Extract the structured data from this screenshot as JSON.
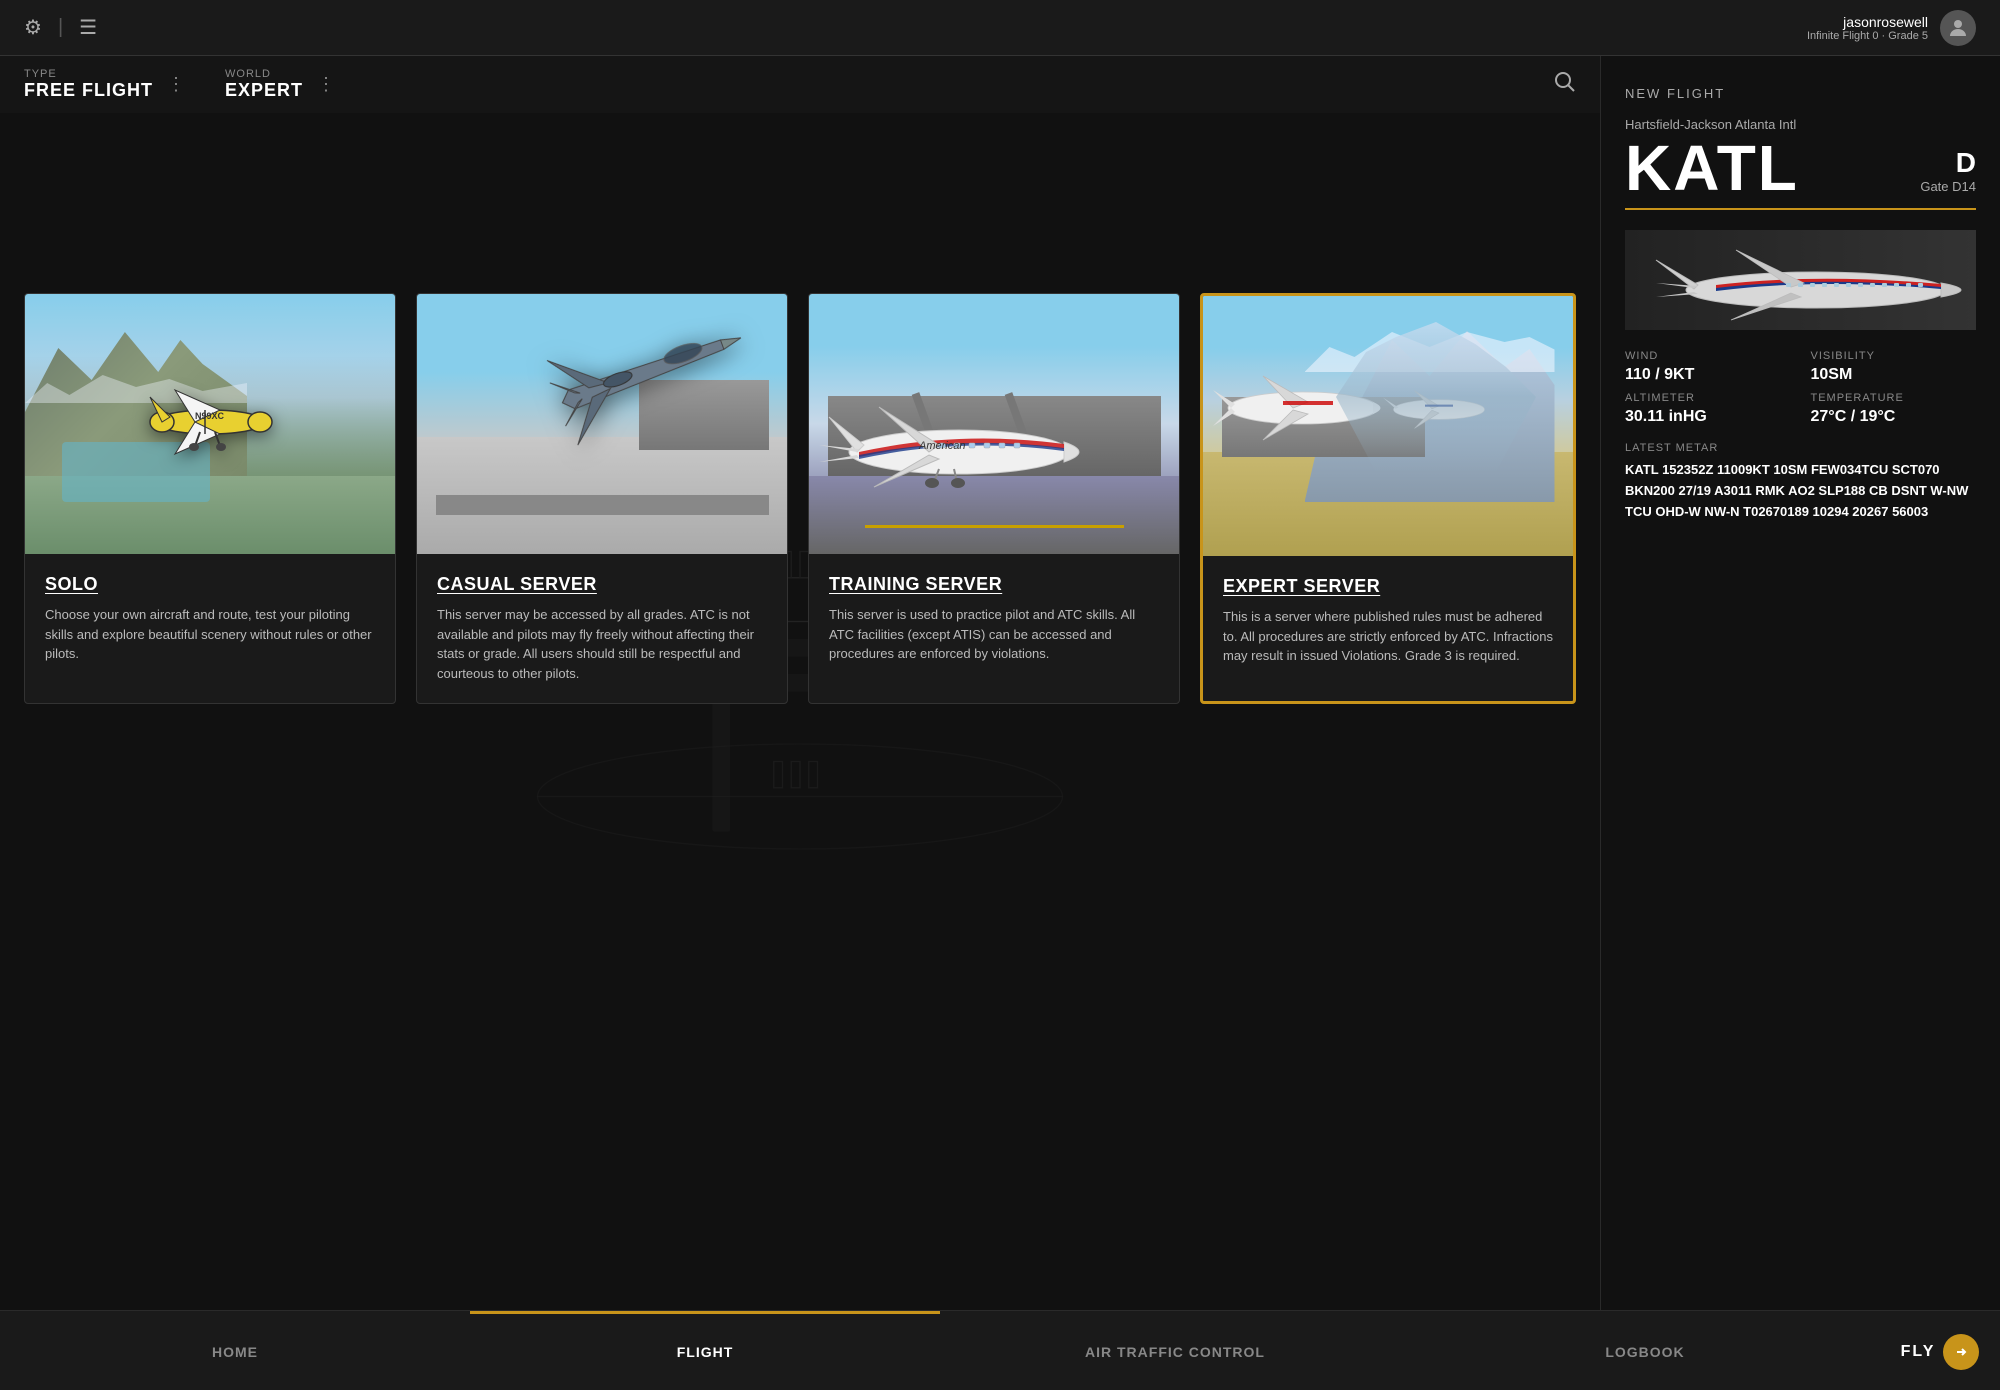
{
  "topbar": {
    "username": "jasonrosewell",
    "grade": "Infinite Flight 0 · Grade 5",
    "settings_icon": "⚙",
    "log_icon": "☰"
  },
  "selector": {
    "type_label": "TYPE",
    "type_value": "FREE FLIGHT",
    "world_label": "WORLD",
    "world_value": "EXPERT"
  },
  "new_flight": {
    "label": "NEW FLIGHT",
    "airport_sub": "Hartsfield-Jackson Atlanta Intl",
    "airport_code": "KATL",
    "gate_letter": "D",
    "gate_label": "Gate D14"
  },
  "servers": [
    {
      "id": "solo",
      "title": "SOLO",
      "description": "Choose your own aircraft and route, test your piloting skills and explore beautiful scenery without rules or other pilots.",
      "selected": false
    },
    {
      "id": "casual",
      "title": "CASUAL SERVER",
      "description": "This server may be accessed by all grades. ATC is not available and pilots may fly freely without affecting their stats or grade. All users should still be respectful and courteous to other pilots.",
      "selected": false
    },
    {
      "id": "training",
      "title": "TRAINING SERVER",
      "description": "This server is used to practice pilot and ATC skills. All ATC facilities (except ATIS) can be accessed and procedures are enforced by violations.",
      "selected": false
    },
    {
      "id": "expert",
      "title": "EXPERT SERVER",
      "description": "This is a server where published rules must be adhered to. All procedures are strictly enforced by ATC. Infractions may result in issued Violations. Grade 3 is required.",
      "selected": true
    }
  ],
  "weather": {
    "altimeter_label": "ALTIMETER",
    "altimeter_value": "30.11 inHG",
    "temperature_label": "TEMPERATURE",
    "temperature_value": "27°C / 19°C",
    "wind_label": "WIND",
    "wind_value": "110 / 9KT",
    "visibility_label": "VISIBILITY",
    "visibility_value": "10SM"
  },
  "metar": {
    "label": "LATEST METAR",
    "value": "KATL 152352Z 11009KT 10SM FEW034TCU SCT070 BKN200 27/19 A3011 RMK AO2 SLP188 CB DSNT W-NW TCU OHD-W NW-N T02670189 10294 20267 56003"
  },
  "nav": {
    "home": "HOME",
    "flight": "FLIGHT",
    "atc": "AIR TRAFFIC CONTROL",
    "logbook": "LOGBOOK",
    "fly": "FLY"
  }
}
